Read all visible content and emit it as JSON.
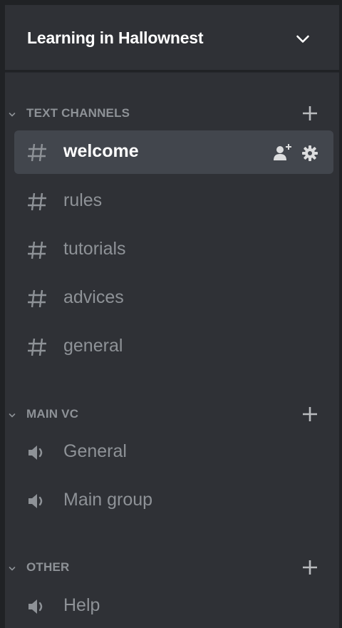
{
  "server": {
    "name": "Learning in Hallownest",
    "menu_icon": "chevron-down-icon"
  },
  "colors": {
    "sidebar_bg": "#2f3136",
    "outer_bg": "#202225",
    "selected_bg": "#42464d",
    "muted_text": "#8e9297",
    "bright_text": "#ffffff"
  },
  "categories": [
    {
      "label": "TEXT CHANNELS",
      "collapse_icon": "chevron-down-icon",
      "add_icon": "plus-icon",
      "channels": [
        {
          "label": "welcome",
          "icon": "hash-icon",
          "selected": true,
          "actions": [
            "invite-icon",
            "gear-icon"
          ]
        },
        {
          "label": "rules",
          "icon": "hash-icon"
        },
        {
          "label": "tutorials",
          "icon": "hash-icon"
        },
        {
          "label": "advices",
          "icon": "hash-icon"
        },
        {
          "label": "general",
          "icon": "hash-icon"
        }
      ]
    },
    {
      "label": "MAIN VC",
      "collapse_icon": "chevron-down-icon",
      "add_icon": "plus-icon",
      "channels": [
        {
          "label": "General",
          "icon": "speaker-icon"
        },
        {
          "label": "Main group",
          "icon": "speaker-icon"
        }
      ]
    },
    {
      "label": "OTHER",
      "collapse_icon": "chevron-down-icon",
      "add_icon": "plus-icon",
      "channels": [
        {
          "label": "Help",
          "icon": "speaker-icon"
        }
      ]
    }
  ]
}
